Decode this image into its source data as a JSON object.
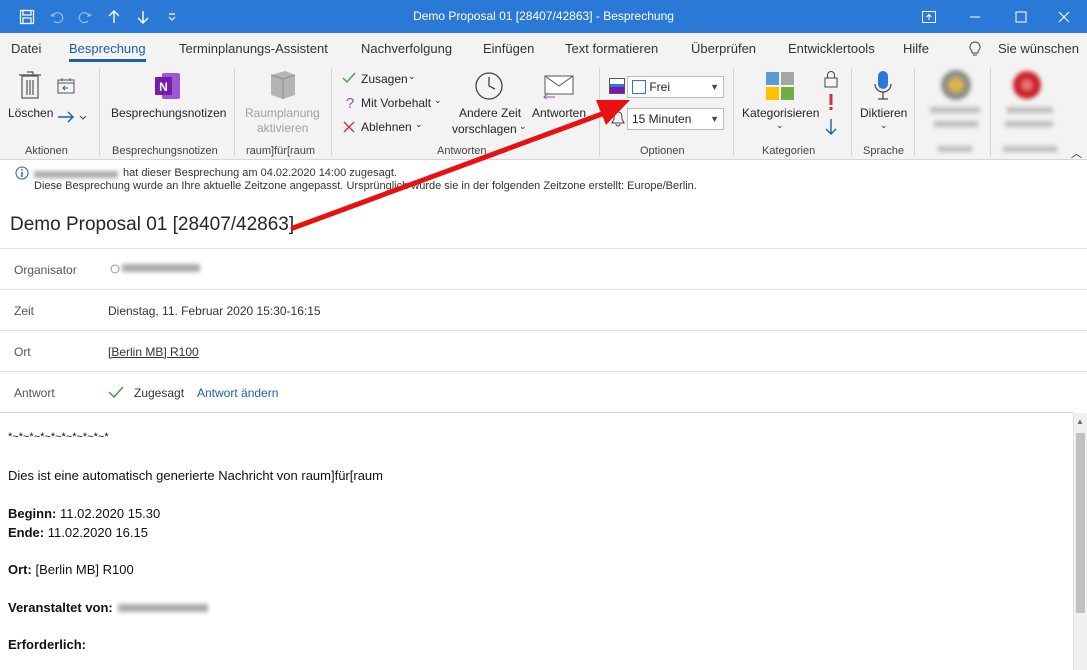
{
  "titlebar": {
    "title": "Demo Proposal 01 [28407/42863]  -  Besprechung"
  },
  "tabs": [
    "Datei",
    "Besprechung",
    "Terminplanungs-Assistent",
    "Nachverfolgung",
    "Einfügen",
    "Text formatieren",
    "Überprüfen",
    "Entwicklertools",
    "Hilfe",
    "Sie wünschen"
  ],
  "ribbon": {
    "delete": "Löschen",
    "group_actions": "Aktionen",
    "onenote": "Besprechungsnotizen",
    "group_notes": "Besprechungsnotizen",
    "room_line1": "Raumplanung",
    "room_line2": "aktivieren",
    "group_room": "raum]für[raum",
    "accept": "Zusagen",
    "tentative": "Mit Vorbehalt",
    "decline": "Ablehnen",
    "propose_line1": "Andere Zeit",
    "propose_line2": "vorschlagen",
    "respond": "Antworten",
    "group_respond": "Antworten",
    "show_as": "Frei",
    "reminder": "15 Minuten",
    "group_options": "Optionen",
    "categorize": "Kategorisieren",
    "group_tags": "Kategorien",
    "dictate": "Diktieren",
    "group_voice": "Sprache"
  },
  "infobar": {
    "line1": "hat dieser Besprechung am 04.02.2020 14:00 zugesagt.",
    "line2": "Diese Besprechung wurde an Ihre aktuelle Zeitzone angepasst. Ursprünglich wurde sie in der folgenden Zeitzone erstellt: Europe/Berlin."
  },
  "subject": "Demo Proposal 01 [28407/42863]",
  "fields": {
    "organizer_label": "Organisator",
    "time_label": "Zeit",
    "time_value": "Dienstag, 11. Februar 2020 15:30-16:15",
    "location_label": "Ort",
    "location_value": "[Berlin MB] R100",
    "response_label": "Antwort",
    "response_value": "Zugesagt",
    "response_change": "Antwort ändern"
  },
  "body": {
    "stars": "*~*~*~*~*~*~*~*~*~*",
    "intro": "Dies ist eine automatisch generierte Nachricht von raum]für[raum",
    "begin_label": "Beginn:",
    "begin_value": " 11.02.2020 15.30",
    "end_label": "Ende:",
    "end_value": " 11.02.2020 16.15",
    "location_label": "Ort:",
    "location_value": " [Berlin MB] R100",
    "organizer_label": "Veranstaltet von:",
    "required_label": "Erforderlich:"
  },
  "colors": {
    "titlebar": "#2b79d6",
    "accent": "#1d5fa8",
    "onenote": "#7719aa",
    "arrow": "#e81010"
  }
}
